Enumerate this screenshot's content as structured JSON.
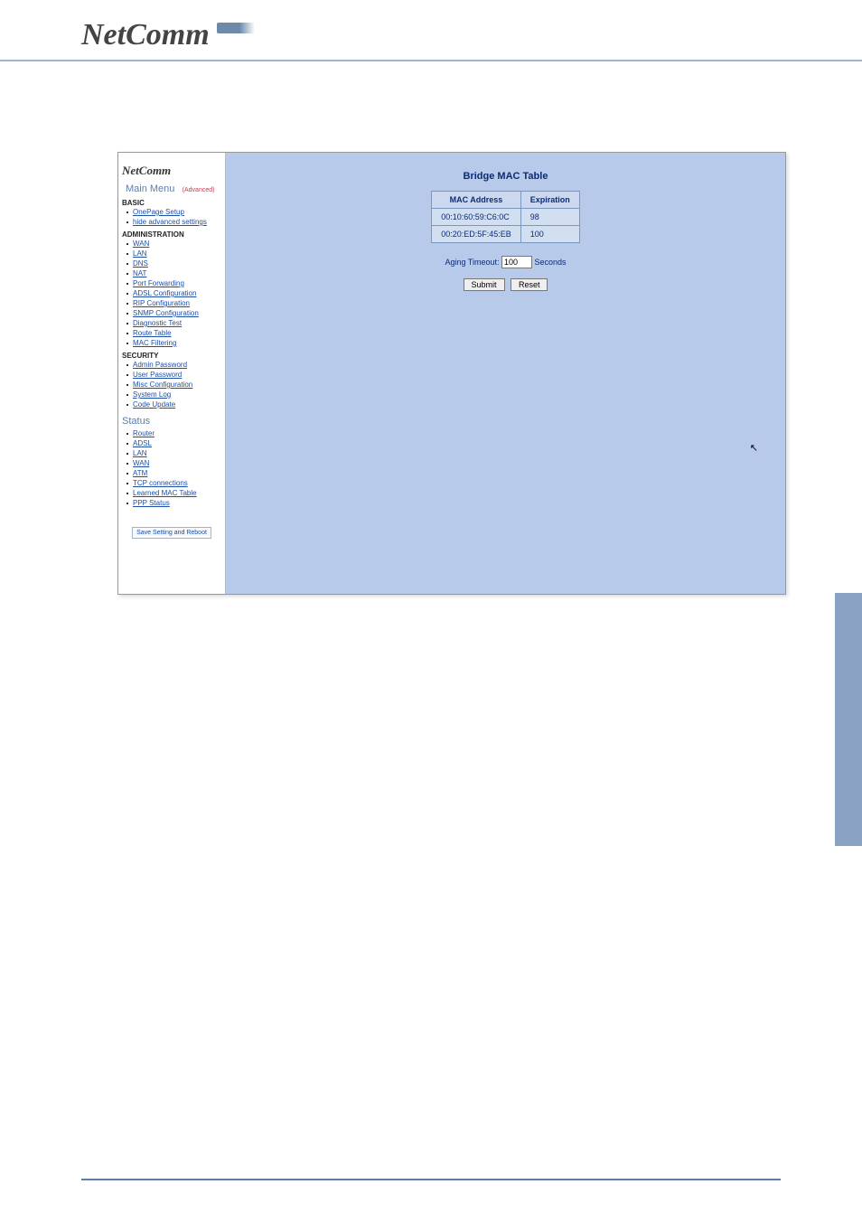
{
  "brand": "NetComm",
  "sidebar": {
    "logo": "NetComm",
    "main_menu": "Main Menu",
    "advanced": "(Advanced)",
    "sections": {
      "basic": {
        "label": "BASIC",
        "items": [
          "OnePage Setup",
          "hide advanced settings"
        ]
      },
      "administration": {
        "label": "ADMINISTRATION",
        "items": [
          "WAN",
          "LAN",
          "DNS",
          "NAT",
          "Port Forwarding",
          "ADSL Configuration",
          "RIP Configuration",
          "SNMP Configuration",
          "Diagnostic Test",
          "Route Table",
          "MAC Filtering"
        ]
      },
      "security": {
        "label": "SECURITY",
        "items": [
          "Admin Password",
          "User Password",
          "Misc Configuration",
          "System Log",
          "Code Update"
        ]
      }
    },
    "status_label": "Status",
    "status_items": [
      "Router",
      "ADSL",
      "LAN",
      "WAN",
      "ATM",
      "TCP connections",
      "Learned MAC Table",
      "PPP Status"
    ],
    "save_btn": "Save Setting and Reboot"
  },
  "content": {
    "title": "Bridge MAC Table",
    "headers": {
      "mac": "MAC Address",
      "exp": "Expiration"
    },
    "rows": [
      {
        "mac": "00:10:60:59:C6:0C",
        "exp": "98"
      },
      {
        "mac": "00:20:ED:5F:45:EB",
        "exp": "100"
      }
    ],
    "aging_label": "Aging Timeout:",
    "aging_value": "100",
    "aging_unit": "Seconds",
    "submit": "Submit",
    "reset": "Reset"
  }
}
